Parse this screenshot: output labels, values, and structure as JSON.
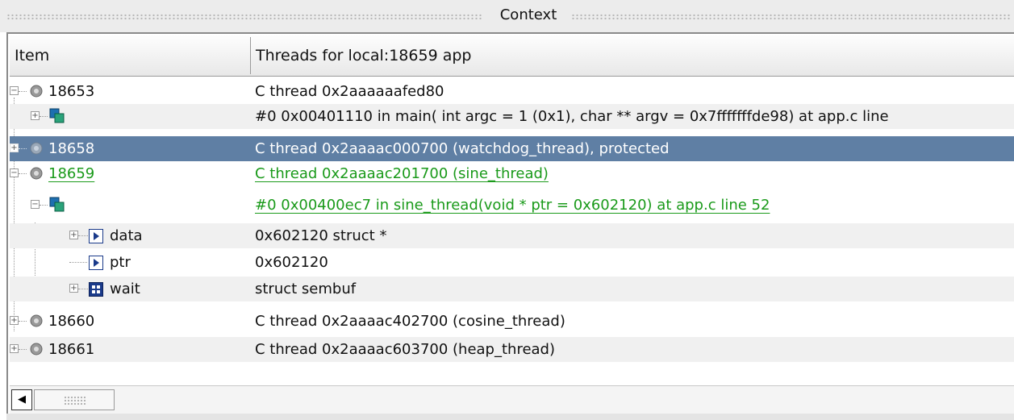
{
  "panel": {
    "title": "Context"
  },
  "columns": {
    "item": "Item",
    "value": "Threads for local:18659 app"
  },
  "rows": [
    {
      "item": "18653",
      "value": "C thread 0x2aaaaaafed80"
    },
    {
      "item": "",
      "value": "#0 0x00401110 in main( int argc = 1 (0x1), char ** argv = 0x7fffffffde98) at app.c line"
    },
    {
      "item": "18658",
      "value": "C thread 0x2aaaac000700 (watchdog_thread), protected"
    },
    {
      "item": "18659",
      "value": "C thread 0x2aaaac201700 (sine_thread)"
    },
    {
      "item": "",
      "value": "#0 0x00400ec7 in sine_thread(void * ptr = 0x602120) at app.c line 52"
    },
    {
      "item": "data",
      "value": "0x602120 struct *"
    },
    {
      "item": "ptr",
      "value": "0x602120"
    },
    {
      "item": "wait",
      "value": "struct sembuf"
    },
    {
      "item": "18660",
      "value": "C thread 0x2aaaac402700 (cosine_thread)"
    },
    {
      "item": "18661",
      "value": "C thread 0x2aaaac603700 (heap_thread)"
    }
  ],
  "icons": {
    "process": "gear-icon",
    "frame": "stack-frame-icon",
    "pointer": "pointer-var-icon",
    "struct": "struct-var-icon"
  },
  "colors": {
    "selection": "#5f7fa4",
    "current_thread": "#1a9a1a",
    "alt_row": "#f0f0f0"
  },
  "scrollbar": {
    "left_arrow": "◀"
  }
}
